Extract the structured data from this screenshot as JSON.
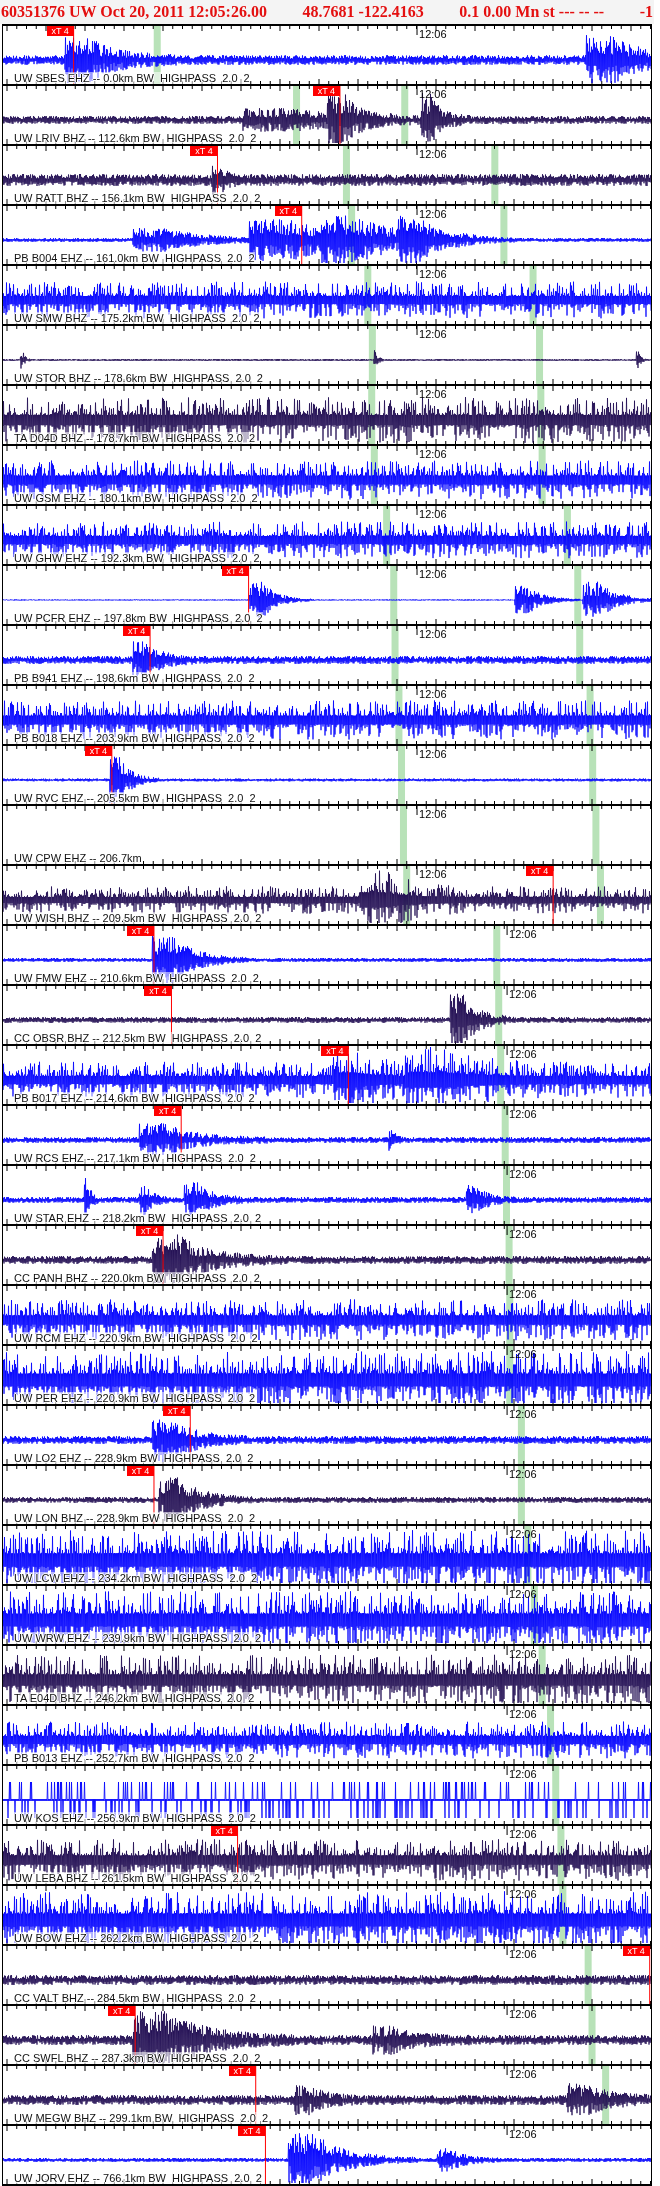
{
  "header": {
    "parts": [
      "60351376 UW Oct 20, 2011 12:05:26.00",
      "48.7681 -122.4163",
      "0.1 0.00 Mn st --- -- --",
      "-1"
    ]
  },
  "traces": [
    {
      "label": "UW SBES EHZ -- 0.0km BW  HIGHPASS  2.0  2",
      "time_label": "12:06",
      "color": "#0000ff",
      "pick": "xT 4"
    },
    {
      "label": "UW LRIV BHZ -- 112.6km BW  HIGHPASS  2.0  2",
      "time_label": "12:06",
      "color": "#1e0a50",
      "pick": "xT 4"
    },
    {
      "label": "UW RATT BHZ -- 156.1km BW  HIGHPASS  2.0  2",
      "time_label": "12:06",
      "color": "#1e0a50",
      "pick": "xT 4"
    },
    {
      "label": "PB B004 EHZ -- 161.0km BW  HIGHPASS  2.0  2",
      "time_label": "12:06",
      "color": "#0000ff",
      "pick": "xT 4"
    },
    {
      "label": "UW SMW BHZ -- 175.2km BW  HIGHPASS  2.0  2",
      "time_label": "12:06",
      "color": "#0000ff"
    },
    {
      "label": "UW STOR BHZ -- 178.6km BW  HIGHPASS  2.0  2",
      "time_label": "12:06",
      "color": "#1e0a50"
    },
    {
      "label": "TA D04D BHZ -- 178.7km BW  HIGHPASS  2.0  2",
      "time_label": "12:06",
      "color": "#1e0a50"
    },
    {
      "label": "UW GSM EHZ -- 180.1km BW  HIGHPASS  2.0  2",
      "time_label": "12:06",
      "color": "#0000ff"
    },
    {
      "label": "UW GHW EHZ -- 192.3km BW  HIGHPASS  2.0  2",
      "time_label": "12:06",
      "color": "#0000ff"
    },
    {
      "label": "UW PCFR EHZ -- 197.8km BW  HIGHPASS  2.0  2",
      "time_label": "12:06",
      "color": "#0000ff",
      "pick": "xT 4"
    },
    {
      "label": "PB B941 EHZ -- 198.6km BW  HIGHPASS  2.0  2",
      "time_label": "12:06",
      "color": "#0000ff",
      "pick": "xT 4"
    },
    {
      "label": "PB B018 EHZ -- 203.9km BW  HIGHPASS  2.0  2",
      "time_label": "12:06",
      "color": "#0000ff"
    },
    {
      "label": "UW RVC EHZ -- 205.5km BW  HIGHPASS  2.0  2",
      "time_label": "12:06",
      "color": "#0000ff",
      "pick": "xT 4"
    },
    {
      "label": "UW CPW EHZ -- 206.7km",
      "time_label": "12:06"
    },
    {
      "label": "UW WISH BHZ -- 209.5km BW  HIGHPASS  2.0  2",
      "time_label": "12:06",
      "color": "#1e0a50",
      "pick": "xT 4"
    },
    {
      "label": "UW FMW EHZ -- 210.6km BW  HIGHPASS  2.0  2",
      "time_label": "12:06",
      "color": "#0000ff",
      "pick": "xT 4"
    },
    {
      "label": "CC OBSR BHZ -- 212.5km BW  HIGHPASS  2.0  2",
      "time_label": "12:06",
      "color": "#1e0a50",
      "pick": "xT 4"
    },
    {
      "label": "PB B017 EHZ -- 214.6km BW  HIGHPASS  2.0  2",
      "time_label": "12:06",
      "color": "#0000ff",
      "pick": "xT 4"
    },
    {
      "label": "UW RCS EHZ -- 217.1km BW  HIGHPASS  2.0  2",
      "time_label": "12:06",
      "color": "#0000ff",
      "pick": "xT 4"
    },
    {
      "label": "UW STAR EHZ -- 218.2km BW  HIGHPASS  2.0  2",
      "time_label": "12:06",
      "color": "#0000ff"
    },
    {
      "label": "CC PANH BHZ -- 220.0km BW  HIGHPASS  2.0  2",
      "time_label": "12:06",
      "color": "#1e0a50",
      "pick": "xT 4"
    },
    {
      "label": "UW RCM EHZ -- 220.9km BW  HIGHPASS  2.0  2",
      "time_label": "12:06",
      "color": "#0000ff"
    },
    {
      "label": "UW PER EHZ -- 220.9km BW  HIGHPASS  2.0  2",
      "time_label": "12:06",
      "color": "#0000ff"
    },
    {
      "label": "UW LO2 EHZ -- 228.9km BW  HIGHPASS  2.0  2",
      "time_label": "12:06",
      "color": "#0000ff",
      "pick": "xT 4"
    },
    {
      "label": "UW LON BHZ -- 228.9km BW  HIGHPASS  2.0  2",
      "time_label": "12:06",
      "color": "#1e0a50",
      "pick": "xT 4"
    },
    {
      "label": "UW LCW EHZ -- 234.2km BW  HIGHPASS  2.0  2",
      "time_label": "12:06",
      "color": "#0000ff"
    },
    {
      "label": "UW WRW EHZ -- 239.9km BW  HIGHPASS  2.0  2",
      "time_label": "12:06",
      "color": "#0000ff"
    },
    {
      "label": "TA E04D BHZ -- 246.2km BW  HIGHPASS  2.0  2",
      "time_label": "12:06",
      "color": "#1e0a50"
    },
    {
      "label": "PB B013 EHZ -- 252.7km BW  HIGHPASS  2.0  2",
      "time_label": "12:06",
      "color": "#0000ff"
    },
    {
      "label": "UW KOS EHZ -- 256.9km BW  HIGHPASS  2.0  2",
      "time_label": "12:06",
      "color": "#0000ff"
    },
    {
      "label": "UW LEBA BHZ -- 261.5km BW  HIGHPASS  2.0  2",
      "time_label": "12:06",
      "color": "#1e0a50",
      "pick": "xT 4"
    },
    {
      "label": "UW BOW EHZ -- 262.2km BW  HIGHPASS  2.0  2",
      "time_label": "12:06",
      "color": "#0000ff"
    },
    {
      "label": "CC VALT BHZ -- 284.5km BW  HIGHPASS  2.0  2",
      "time_label": "12:06",
      "color": "#1e0a50",
      "pick": "xT 4"
    },
    {
      "label": "CC SWFL BHZ -- 287.3km BW  HIGHPASS  2.0  2",
      "time_label": "12:06",
      "color": "#1e0a50",
      "pick": "xT 4"
    },
    {
      "label": "UW MEGW BHZ -- 299.1km BW  HIGHPASS  2.0  2",
      "time_label": "12:06",
      "color": "#1e0a50",
      "pick": "xT 4"
    },
    {
      "label": "UW JORV EHZ -- 766.1km BW  HIGHPASS  2.0  2",
      "time_label": "12:06",
      "color": "#0000ff",
      "pick": "xT 4"
    }
  ]
}
